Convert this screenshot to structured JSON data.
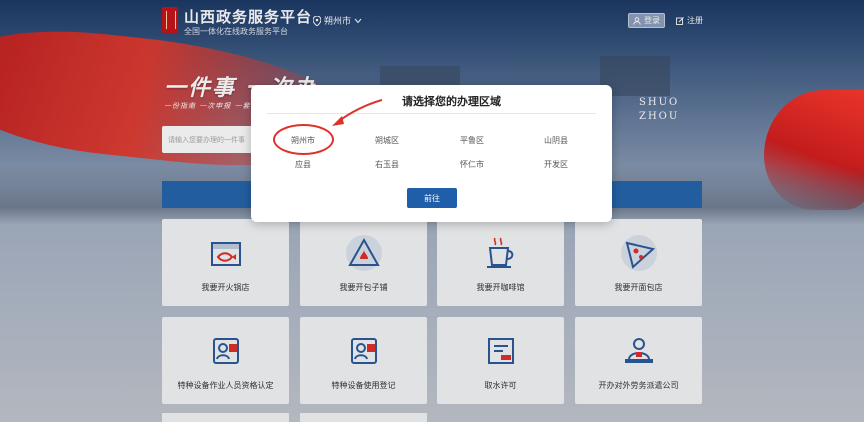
{
  "header": {
    "site_title": "山西政务服务平台",
    "site_subtitle": "全国一体化在线政务服务平台",
    "city": "朔州市",
    "login_label": "登录",
    "register_label": "注册"
  },
  "hero": {
    "slogan": "一件事 一次办",
    "slogan_sub": "一份指南 一次申报 一套材料",
    "city_name_en_1": "SHUO",
    "city_name_en_2": "ZHOU",
    "search_placeholder": "请输入您要办理的一件事"
  },
  "services": [
    {
      "label": "我要开火锅店",
      "icon": "hotpot-store-icon"
    },
    {
      "label": "我要开包子铺",
      "icon": "bun-shop-icon"
    },
    {
      "label": "我要开咖啡馆",
      "icon": "coffee-cup-icon"
    },
    {
      "label": "我要开面包店",
      "icon": "pizza-slice-icon"
    },
    {
      "label": "特种设备作业人员资格认定",
      "icon": "special-id-badge-icon"
    },
    {
      "label": "特种设备使用登记",
      "icon": "equipment-badge-icon"
    },
    {
      "label": "取水许可",
      "icon": "water-permit-icon"
    },
    {
      "label": "开办对外劳务派遣公司",
      "icon": "labor-dispatch-icon"
    }
  ],
  "modal": {
    "title": "请选择您的办理区域",
    "areas": [
      "朔州市",
      "朔城区",
      "平鲁区",
      "山阴县",
      "应县",
      "右玉县",
      "怀仁市",
      "开发区"
    ],
    "selected_area": "朔州市",
    "confirm_label": "前往"
  },
  "colors": {
    "brand_blue": "#1f5ea8",
    "brand_red": "#c8141c",
    "annotation_red": "#e0302a"
  }
}
